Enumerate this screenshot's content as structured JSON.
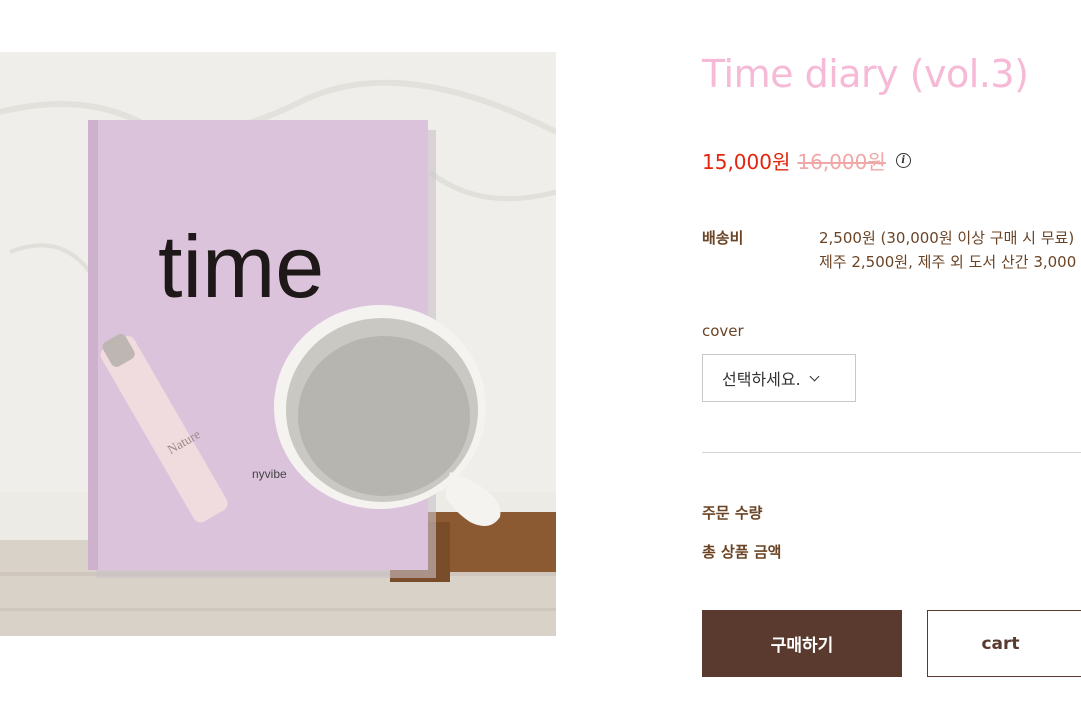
{
  "product": {
    "title": "Time diary (vol.3)",
    "image_alt": "Time diary book with mug and tube",
    "image_text": {
      "cover_word": "time",
      "cover_small": "nyvibe",
      "tube_text": "Nature"
    },
    "sale_price": "15,000원",
    "original_price": "16,000원",
    "info_icon": "i"
  },
  "shipping": {
    "label": "배송비",
    "line1": "2,500원 (30,000원 이상 구매 시 무료)",
    "line2": "제주 2,500원, 제주 외 도서 산간 3,000"
  },
  "option": {
    "label": "cover",
    "selected": "선택하세요."
  },
  "order": {
    "quantity_label": "주문 수량",
    "total_label": "총 상품 금액"
  },
  "buttons": {
    "buy": "구매하기",
    "cart": "cart"
  },
  "colors": {
    "title": "#f6b9d6",
    "sale_price": "#e3250f",
    "original_price": "#f0a7a7",
    "text_brown": "#6b4426",
    "buy_bg": "#5a3a2e"
  }
}
